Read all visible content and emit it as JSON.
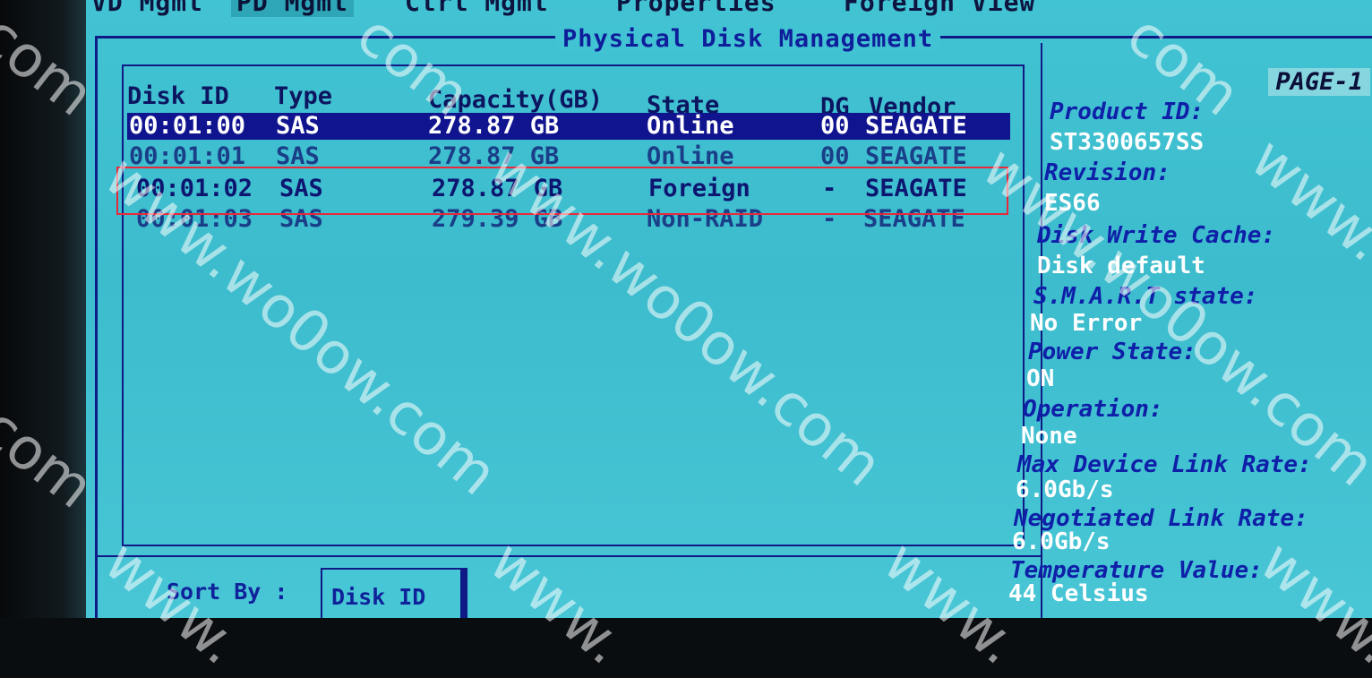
{
  "tabs": [
    "VD Mgmt",
    "PD Mgmt",
    "Ctrl Mgmt",
    "Properties",
    "Foreign View"
  ],
  "panel_title": "Physical Disk Management",
  "columns": [
    "Disk ID",
    "Type",
    "Capacity(GB)",
    "State",
    "DG",
    "Vendor"
  ],
  "disks": [
    {
      "id": "00:01:00",
      "type": "SAS",
      "capacity": "278.87 GB",
      "state": "Online",
      "dg": "00",
      "vendor": "SEAGATE"
    },
    {
      "id": "00:01:01",
      "type": "SAS",
      "capacity": "278.87 GB",
      "state": "Online",
      "dg": "00",
      "vendor": "SEAGATE"
    },
    {
      "id": "00:01:02",
      "type": "SAS",
      "capacity": "278.87 GB",
      "state": "Foreign",
      "dg": "-",
      "vendor": "SEAGATE"
    },
    {
      "id": "00:01:03",
      "type": "SAS",
      "capacity": "279.39 GB",
      "state": "Non-RAID",
      "dg": "-",
      "vendor": "SEAGATE"
    }
  ],
  "sort": {
    "label": "Sort By :",
    "value": "Disk ID"
  },
  "details": {
    "page": "PAGE-1",
    "product_id_label": "Product ID:",
    "product_id": "ST3300657SS",
    "revision_label": "Revision:",
    "revision": "ES66",
    "cache_label": "Disk Write Cache:",
    "cache": "Disk default",
    "smart_label": "S.M.A.R.T state:",
    "smart": "No Error",
    "power_label": "Power State:",
    "power": "ON",
    "operation_label": "Operation:",
    "operation": "None",
    "max_rate_label": "Max Device Link Rate:",
    "max_rate": "6.0Gb/s",
    "neg_rate_label": "Negotiated Link Rate:",
    "neg_rate": "6.0Gb/s",
    "temp_label": "Temperature Value:",
    "temp": "44 Celsius"
  },
  "watermark": {
    "domain": "www.wo0ow.com",
    "short": "com",
    "prefix": "www."
  },
  "colors": {
    "screen": "#42c3d3",
    "selected_row": "#10148e",
    "frame": "#0f1a86",
    "highlight": "#e8293a"
  }
}
